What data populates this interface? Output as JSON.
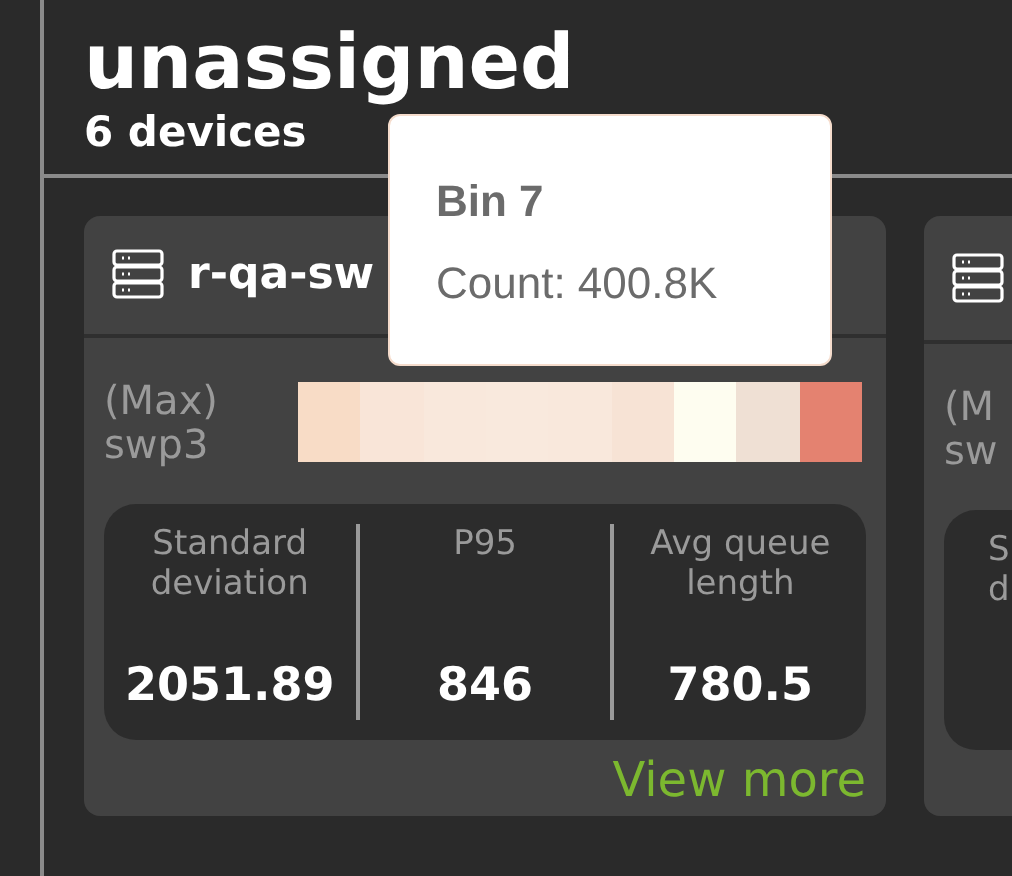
{
  "group": {
    "title": "unassigned",
    "subtitle": "6 devices"
  },
  "cards": [
    {
      "name": "r-qa-sw",
      "heat_label": [
        "(Max)",
        "swp3"
      ],
      "heatmap": [
        {
          "color": "#f8dcc6"
        },
        {
          "color": "#f9e5d8"
        },
        {
          "color": "#f9e8dc"
        },
        {
          "color": "#f9e9dd"
        },
        {
          "color": "#f9e8dc"
        },
        {
          "color": "#f7e3d5"
        },
        {
          "color": "#fefdf0"
        },
        {
          "color": "#efe0d4"
        },
        {
          "color": "#e48270"
        }
      ],
      "stats": [
        {
          "label": [
            "Standard",
            "deviation"
          ],
          "value": "2051.89"
        },
        {
          "label": [
            "P95"
          ],
          "value": "846"
        },
        {
          "label": [
            "Avg queue",
            "length"
          ],
          "value": "780.5"
        }
      ],
      "link": "View more"
    },
    {
      "heat_label": [
        "(M",
        "sw"
      ],
      "stats": [
        {
          "label": [
            "S",
            "d"
          ]
        }
      ]
    }
  ],
  "tooltip": {
    "title": "Bin 7",
    "text": "Count: 400.8K"
  }
}
